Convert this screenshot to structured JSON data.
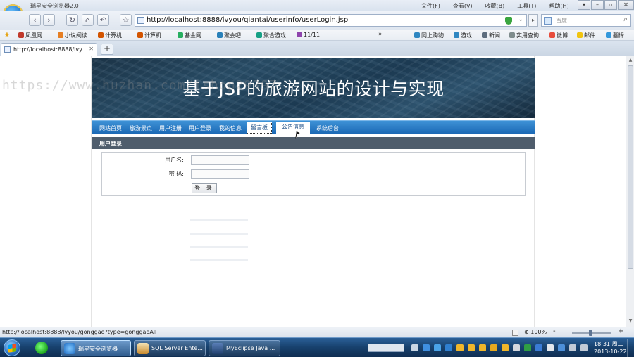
{
  "browser": {
    "app_title": "瑞星安全浏览器2.0",
    "menus": [
      "文件(F)",
      "查看(V)",
      "收藏(B)",
      "工具(T)",
      "帮助(H)"
    ],
    "url": "http://localhost:8888/lvyou/qiantai/userinfo/userLogin.jsp",
    "search_placeholder": "百度",
    "favorites": [
      "凤凰网",
      "小说阅读",
      "计算机",
      "计算机",
      "基金网",
      "聚会吧",
      "聚合游戏",
      "11/11"
    ],
    "favorites_right": [
      "网上购物",
      "游戏",
      "新闻",
      "实用查询",
      "微博",
      "邮件",
      "翻译"
    ],
    "tab_title": "http://localhost:8888/lvy...",
    "status_url": "http://localhost:8888/lvyou/gonggao?type=gonggaoAll",
    "zoom": "100%"
  },
  "watermark": "https://www.huzhan.com/ishop29397",
  "site": {
    "title": "基于JSP的旅游网站的设计与实现",
    "menu": [
      "网站首页",
      "旅游景点",
      "用户注册",
      "用户登录",
      "我的信息",
      "留言板",
      "公告信息",
      "系统后台"
    ],
    "section_title": "用户登录",
    "form": {
      "username_label": "用户名:",
      "password_label": "密 码:",
      "login_button": "登 录"
    }
  },
  "taskbar": {
    "tasks": [
      "瑞星安全浏览器",
      "SQL Server Ente...",
      "MyEclipse Java ..."
    ],
    "time": "18:31 周二",
    "date": "2013-10-22"
  }
}
